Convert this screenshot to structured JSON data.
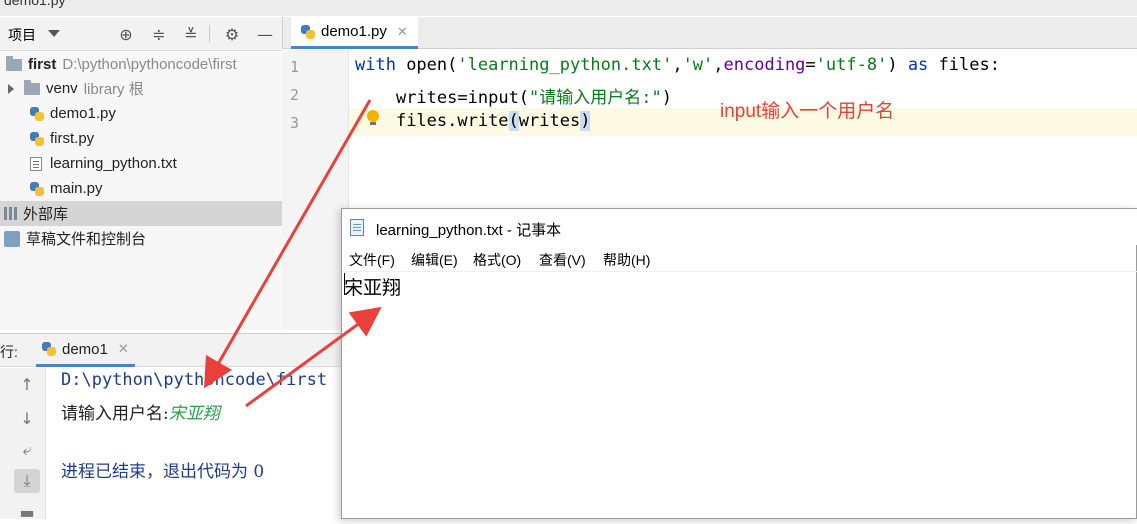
{
  "window": {
    "title": "demo1.py"
  },
  "project_panel": {
    "title": "项目",
    "tree": {
      "root": {
        "label": "first",
        "path": "D:\\python\\pythoncode\\first"
      },
      "items": [
        {
          "label": "venv",
          "sub": "library 根",
          "type": "folder"
        },
        {
          "label": "demo1.py",
          "type": "py"
        },
        {
          "label": "first.py",
          "type": "py"
        },
        {
          "label": "learning_python.txt",
          "type": "txt"
        },
        {
          "label": "main.py",
          "type": "py"
        },
        {
          "label": "外部库",
          "type": "lib"
        },
        {
          "label": "草稿文件和控制台",
          "type": "scratch"
        }
      ]
    }
  },
  "editor": {
    "tab": "demo1.py",
    "line_numbers": [
      "1",
      "2",
      "3"
    ],
    "lines": {
      "l1": {
        "kw_with": "with",
        "open": " open(",
        "s1": "'learning_python.txt'",
        "c1": ",",
        "s2": "'w'",
        "c2": ",",
        "enc": "encoding",
        "eq": "=",
        "s3": "'utf-8'",
        "close": ")",
        "as": " as",
        "files": " files:"
      },
      "l2": {
        "indent": "    ",
        "writes": "writes",
        "eq": "=",
        "input": "input(",
        "str": "\"请输入用户名:\"",
        "close": ")"
      },
      "l3": {
        "indent": "    ",
        "call": "files.write",
        "open": "(",
        "arg": "writes",
        "close": ")"
      }
    },
    "annotation": "input输入一个用户名"
  },
  "run_panel": {
    "label": "行:",
    "tab": "demo1",
    "console": {
      "path": "D:\\python\\pythoncode\\first",
      "prompt": "请输入用户名:",
      "input": "宋亚翔",
      "exit": "进程已结束，退出代码为 0"
    }
  },
  "notepad": {
    "title": "learning_python.txt - 记事本",
    "menu": [
      "文件(F)",
      "编辑(E)",
      "格式(O)",
      "查看(V)",
      "帮助(H)"
    ],
    "content": "宋亚翔"
  },
  "colors": {
    "accent": "#4a83c7",
    "annotation": "#e8403a",
    "console_input": "#27a34a"
  }
}
